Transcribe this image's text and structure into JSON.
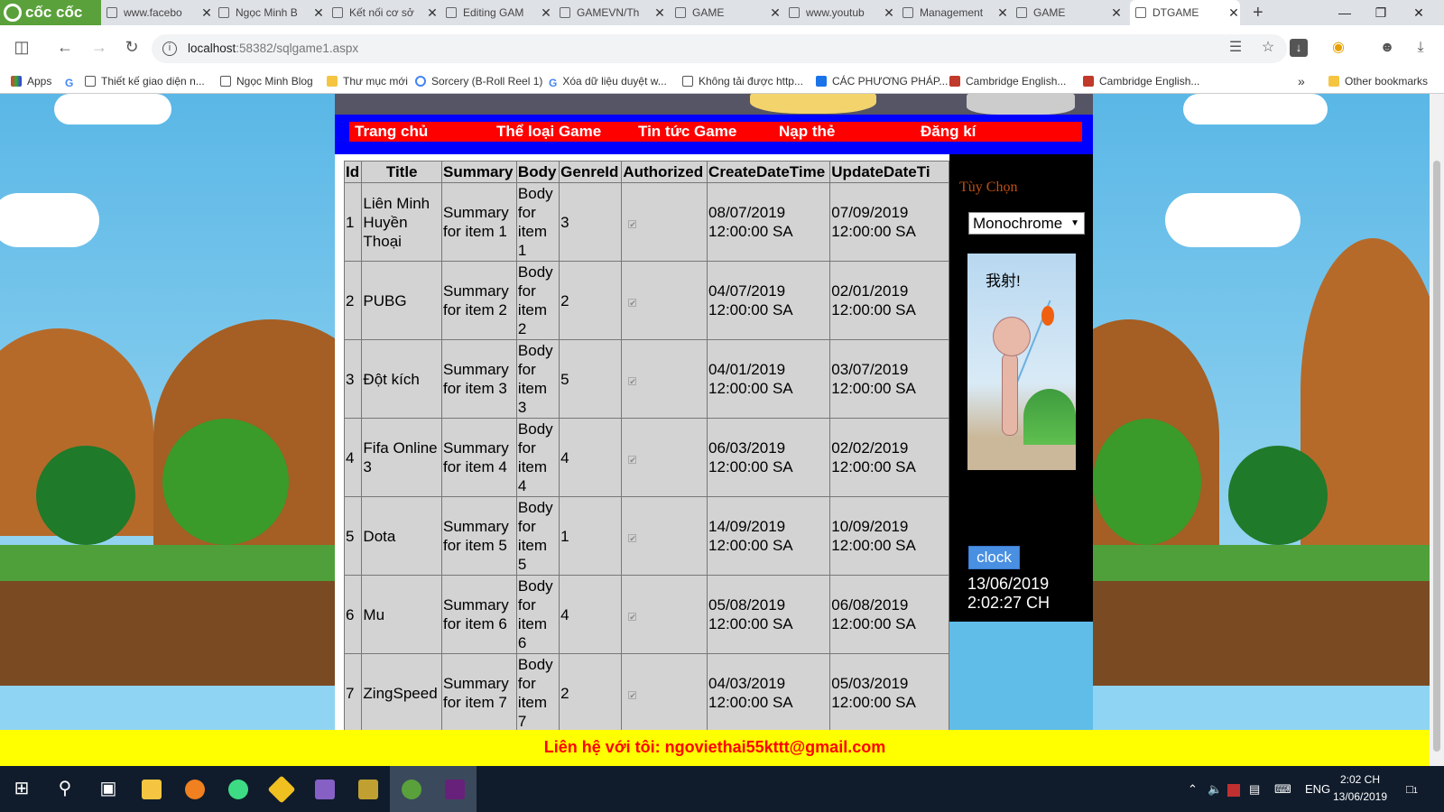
{
  "browser": {
    "brand": "cốc cốc",
    "tabs": [
      {
        "title": "www.facebo"
      },
      {
        "title": "Ngọc Minh B"
      },
      {
        "title": "Kết nối cơ sở"
      },
      {
        "title": "Editing GAM"
      },
      {
        "title": "GAMEVN/Th"
      },
      {
        "title": "GAME"
      },
      {
        "title": "www.youtub"
      },
      {
        "title": "Management"
      },
      {
        "title": "GAME"
      },
      {
        "title": "DTGAME"
      }
    ],
    "new_tab": "+",
    "url_host": "localhost",
    "url_path": ":58382/sqlgame1.aspx",
    "bookmarks": [
      {
        "label": "Apps"
      },
      {
        "label": "Thiết kế giao diện n..."
      },
      {
        "label": "Ngọc Minh Blog"
      },
      {
        "label": "Thư mục mới"
      },
      {
        "label": "Sorcery (B-Roll Reel 1)"
      },
      {
        "label": "Xóa dữ liệu duyệt w..."
      },
      {
        "label": "Không tải được http..."
      },
      {
        "label": "CÁC PHƯƠNG PHÁP..."
      },
      {
        "label": "Cambridge English..."
      },
      {
        "label": "Cambridge English..."
      }
    ],
    "bookmarks_more": "»",
    "other_bookmarks": "Other bookmarks"
  },
  "site": {
    "menu": [
      "Trang chủ",
      "Thể loại Game",
      "Tin tức Game",
      "Nạp thẻ",
      "Đăng kí"
    ],
    "grid": {
      "headers": [
        "Id",
        "Title",
        "Summary",
        "Body",
        "GenreId",
        "Authorized",
        "CreateDateTime",
        "UpdateDateTi"
      ],
      "rows": [
        {
          "id": "1",
          "title": "Liên Minh Huyền Thoại",
          "summary": "Summary for item 1",
          "body": "Body for item 1",
          "genre": "3",
          "created": "08/07/2019\n12:00:00 SA",
          "updated": "07/09/2019\n12:00:00 SA"
        },
        {
          "id": "2",
          "title": "PUBG",
          "summary": "Summary for item 2",
          "body": "Body for item 2",
          "genre": "2",
          "created": "04/07/2019\n12:00:00 SA",
          "updated": "02/01/2019\n12:00:00 SA"
        },
        {
          "id": "3",
          "title": "Đột kích",
          "summary": "Summary for item 3",
          "body": "Body for item 3",
          "genre": "5",
          "created": "04/01/2019\n12:00:00 SA",
          "updated": "03/07/2019\n12:00:00 SA"
        },
        {
          "id": "4",
          "title": "Fifa Online 3",
          "summary": "Summary for item 4",
          "body": "Body for item 4",
          "genre": "4",
          "created": "06/03/2019\n12:00:00 SA",
          "updated": "02/02/2019\n12:00:00 SA"
        },
        {
          "id": "5",
          "title": "Dota",
          "summary": "Summary for item 5",
          "body": "Body for item 5",
          "genre": "1",
          "created": "14/09/2019\n12:00:00 SA",
          "updated": "10/09/2019\n12:00:00 SA"
        },
        {
          "id": "6",
          "title": "Mu",
          "summary": "Summary for item 6",
          "body": "Body for item 6",
          "genre": "4",
          "created": "05/08/2019\n12:00:00 SA",
          "updated": "06/08/2019\n12:00:00 SA"
        },
        {
          "id": "7",
          "title": "ZingSpeed",
          "summary": "Summary for item 7",
          "body": "Body for item 7",
          "genre": "2",
          "created": "04/03/2019\n12:00:00 SA",
          "updated": "05/03/2019\n12:00:00 SA"
        }
      ],
      "checkbox_mark": "✔"
    },
    "sidebar": {
      "options_label": "Tùy Chọn",
      "select_value": "Monochrome",
      "image_caption": "我射!",
      "clock_button": "clock",
      "clock_text": "13/06/2019\n2:02:27 CH"
    },
    "footer": "Liên hệ với tôi: ngoviethai55kttt@gmail.com"
  },
  "taskbar": {
    "lang": "ENG",
    "time": "2:02 CH",
    "date": "13/06/2019",
    "notif_count": "1"
  },
  "colors": {
    "menu_bar": "#0000ff",
    "menu_strip": "#ff0000",
    "footer_bg": "#ffff00",
    "footer_text": "#ff0000",
    "grid_bg": "#d3d3d3"
  }
}
